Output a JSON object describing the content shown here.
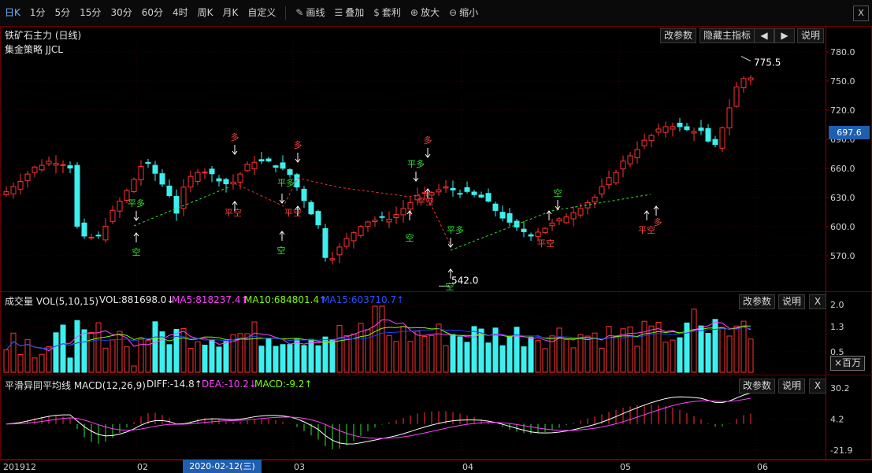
{
  "toolbar": {
    "periods": [
      "日K",
      "1分",
      "5分",
      "15分",
      "30分",
      "60分",
      "4时",
      "周K",
      "月K",
      "自定义"
    ],
    "draw_label": "画线",
    "overlay_label": "叠加",
    "arbitrage_label": "套利",
    "zoom_in_label": "放大",
    "zoom_out_label": "缩小",
    "close_label": "X"
  },
  "main_panel": {
    "title": "铁矿石主力 (日线)",
    "strategy": "集金策略 JJCL",
    "buttons": {
      "params": "改参数",
      "hide": "隐藏主指标",
      "prev": "◀",
      "next": "▶",
      "help": "说明"
    },
    "y_ticks": [
      "780.0",
      "750.0",
      "720.0",
      "690.0",
      "660.0",
      "630.0",
      "600.0",
      "570.0"
    ],
    "current_price": "697.6",
    "high_label": "775.5",
    "low_label": "542.0",
    "signals": {
      "long": "多",
      "short": "空",
      "close_long": "平多",
      "close_short": "平空"
    }
  },
  "volume_panel": {
    "title": "成交量 VOL(5,10,15)",
    "vol": "VOL:881698.0↓",
    "ma5": "MA5:818237.4↑",
    "ma10": "MA10:684801.4↑",
    "ma15": "MA15:603710.7↑",
    "buttons": {
      "params": "改参数",
      "help": "说明",
      "close": "X"
    },
    "y_ticks": [
      "2.0",
      "1.3",
      "0.5"
    ],
    "unit": "×百万"
  },
  "macd_panel": {
    "title": "平滑异同平均线 MACD(12,26,9)",
    "diff": "DIFF:-14.8↑",
    "dea": "DEA:-10.2↓",
    "macd": "MACD:-9.2↑",
    "buttons": {
      "params": "改参数",
      "help": "说明",
      "close": "X"
    },
    "y_ticks": [
      "30.2",
      "4.2",
      "-21.9"
    ]
  },
  "x_axis": {
    "labels": [
      "201912",
      "02",
      "03",
      "04",
      "05",
      "06"
    ],
    "cursor_date": "2020-02-12(三)"
  },
  "colors": {
    "up": "#ff3232",
    "down": "#3df0f0",
    "ma5": "#ff40ff",
    "ma10": "#7cfc00",
    "ma15": "#1e40ff",
    "grid": "#3a0000"
  }
}
